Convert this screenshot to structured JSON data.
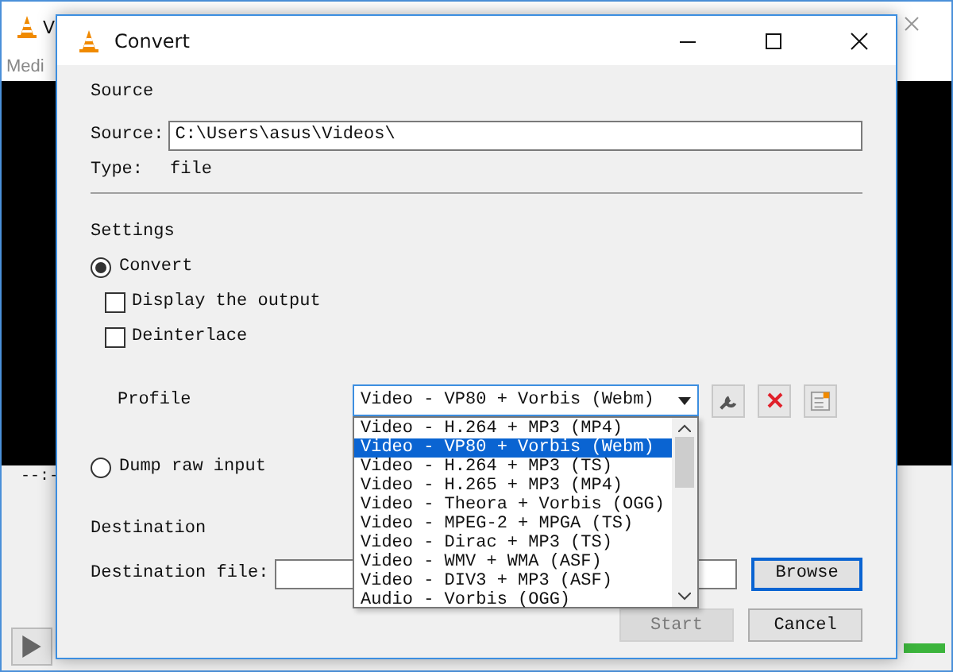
{
  "background_window": {
    "title": "V",
    "menu": [
      "Medi"
    ],
    "time": "--:-"
  },
  "dialog": {
    "title": "Convert"
  },
  "source": {
    "heading": "Source",
    "source_label": "Source:",
    "source_value": "C:\\Users\\asus\\Videos\\",
    "type_label": "Type:",
    "type_value": "file"
  },
  "settings": {
    "heading": "Settings",
    "options": [
      {
        "label": "Convert",
        "selected": true
      },
      {
        "label": "Dump raw input",
        "selected": false
      }
    ],
    "checkboxes": [
      {
        "label": "Display the output",
        "checked": false
      },
      {
        "label": "Deinterlace",
        "checked": false
      }
    ],
    "profile_label": "Profile",
    "profile_value": "Video - VP80 + Vorbis (Webm)",
    "profile_list": [
      {
        "label": "Video - H.264 + MP3 (MP4)",
        "selected": false
      },
      {
        "label": "Video - VP80 + Vorbis (Webm)",
        "selected": true
      },
      {
        "label": "Video - H.264 + MP3 (TS)",
        "selected": false
      },
      {
        "label": "Video - H.265 + MP3 (MP4)",
        "selected": false
      },
      {
        "label": "Video - Theora + Vorbis (OGG)",
        "selected": false
      },
      {
        "label": "Video - MPEG-2 + MPGA (TS)",
        "selected": false
      },
      {
        "label": "Video - Dirac + MP3 (TS)",
        "selected": false
      },
      {
        "label": "Video - WMV + WMA (ASF)",
        "selected": false
      },
      {
        "label": "Video - DIV3 + MP3 (ASF)",
        "selected": false
      },
      {
        "label": "Audio - Vorbis (OGG)",
        "selected": false
      }
    ]
  },
  "destination": {
    "heading": "Destination",
    "file_label": "Destination file:",
    "browse": "Browse"
  },
  "buttons": [
    {
      "label": "Start",
      "disabled": true
    },
    {
      "label": "Cancel",
      "disabled": false
    }
  ]
}
